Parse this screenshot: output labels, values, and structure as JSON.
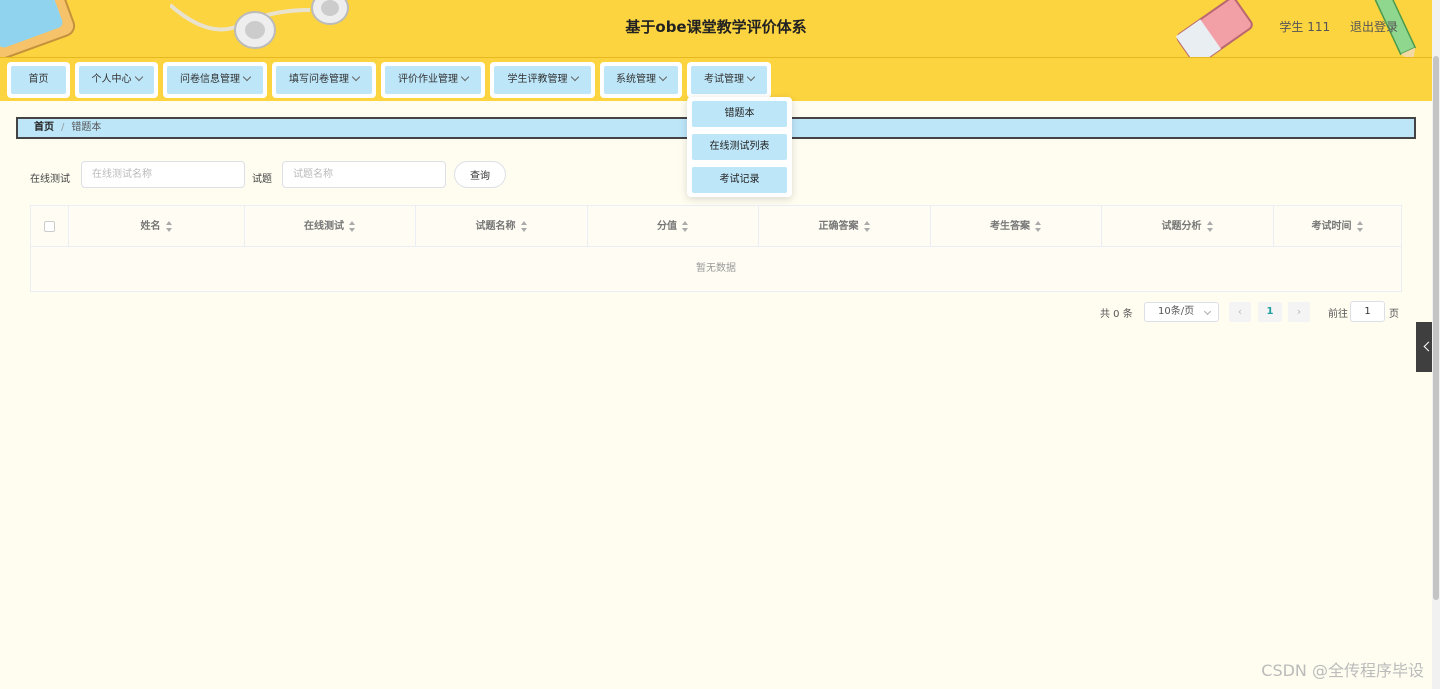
{
  "header": {
    "title": "基于obe课堂教学评价体系",
    "user": "学生 111",
    "logout": "退出登录"
  },
  "nav": [
    {
      "label": "首页",
      "has_dropdown": false
    },
    {
      "label": "个人中心",
      "has_dropdown": true
    },
    {
      "label": "问卷信息管理",
      "has_dropdown": true
    },
    {
      "label": "填写问卷管理",
      "has_dropdown": true
    },
    {
      "label": "评价作业管理",
      "has_dropdown": true
    },
    {
      "label": "学生评教管理",
      "has_dropdown": true
    },
    {
      "label": "系统管理",
      "has_dropdown": true
    },
    {
      "label": "考试管理",
      "has_dropdown": true
    }
  ],
  "dropdown": {
    "items": [
      "错题本",
      "在线测试列表",
      "考试记录"
    ]
  },
  "breadcrumb": {
    "home": "首页",
    "separator": "/",
    "current": "错题本"
  },
  "search": {
    "test_label": "在线测试",
    "test_placeholder": "在线测试名称",
    "question_label": "试题",
    "question_placeholder": "试题名称",
    "query_button": "查询"
  },
  "table": {
    "columns": [
      "姓名",
      "在线测试",
      "试题名称",
      "分值",
      "正确答案",
      "考生答案",
      "试题分析",
      "考试时间"
    ],
    "empty_text": "暂无数据"
  },
  "pagination": {
    "total": "共 0 条",
    "page_size": "10条/页",
    "prev": "‹",
    "current_page": "1",
    "next": "›",
    "goto_label": "前往",
    "goto_value": "1",
    "page_suffix": "页"
  },
  "watermark": "CSDN @全传程序毕设",
  "colors": {
    "header_bg": "#fcd43f",
    "nav_item_bg": "#bde6f9",
    "page_bg": "#fffdf0"
  }
}
